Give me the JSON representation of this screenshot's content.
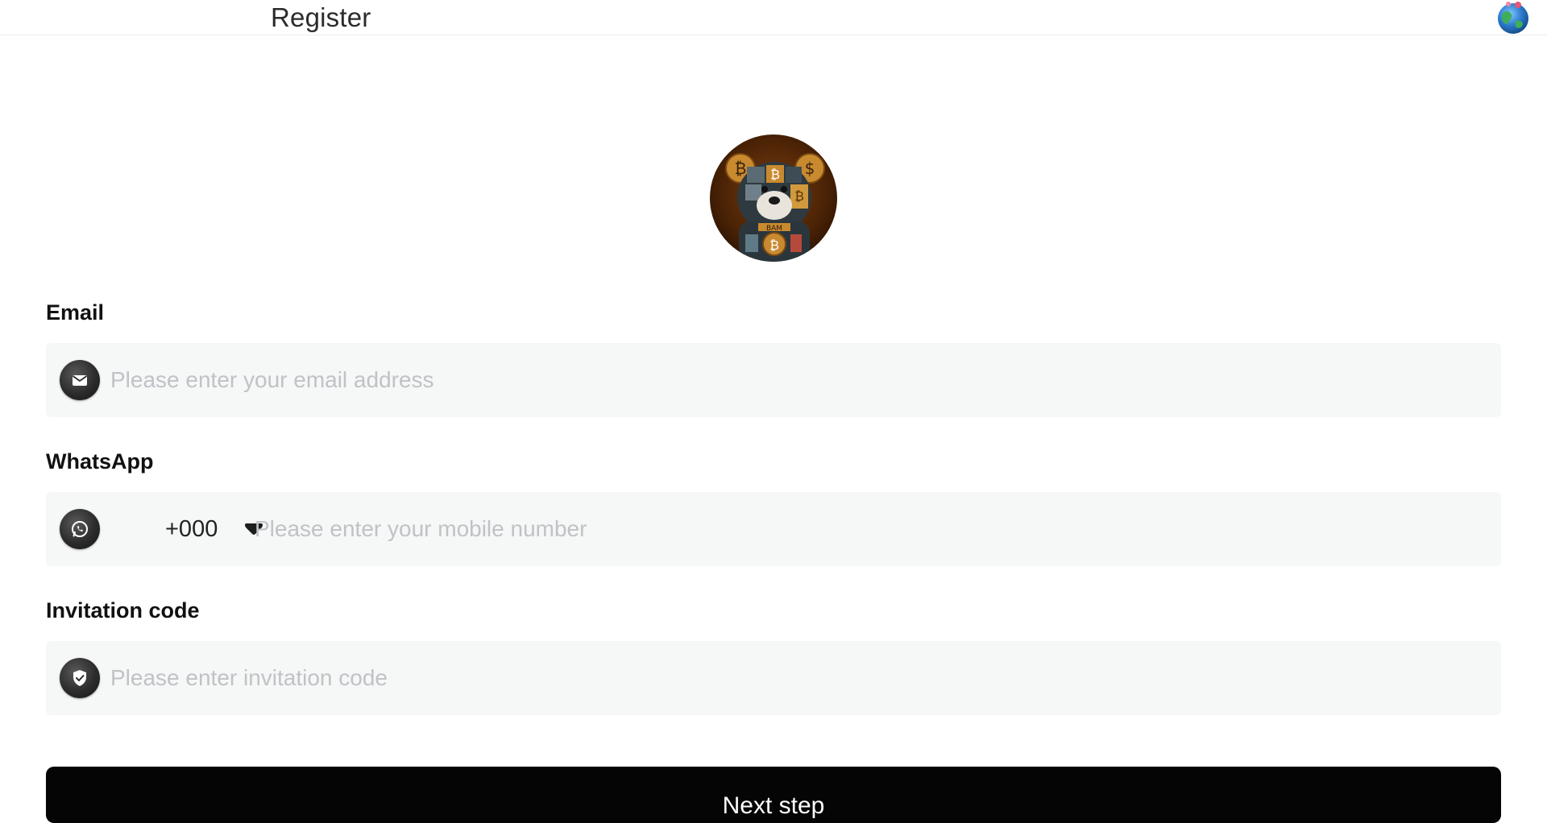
{
  "header": {
    "title": "Register",
    "language_icon": "globe-icon"
  },
  "logo": {
    "icon": "teddy-bear-crypto-logo"
  },
  "form": {
    "email": {
      "label": "Email",
      "placeholder": "Please enter your email address",
      "icon": "envelope-icon"
    },
    "whatsapp": {
      "label": "WhatsApp",
      "country_code": "+000",
      "placeholder": "Please enter your mobile number",
      "icon": "whatsapp-icon"
    },
    "invitation": {
      "label": "Invitation code",
      "placeholder": "Please enter invitation code",
      "icon": "shield-check-icon"
    },
    "submit_label": "Next step"
  },
  "colors": {
    "field_bg": "#f6f7f7",
    "button_bg": "#050505",
    "placeholder": "#bfc3c6"
  }
}
